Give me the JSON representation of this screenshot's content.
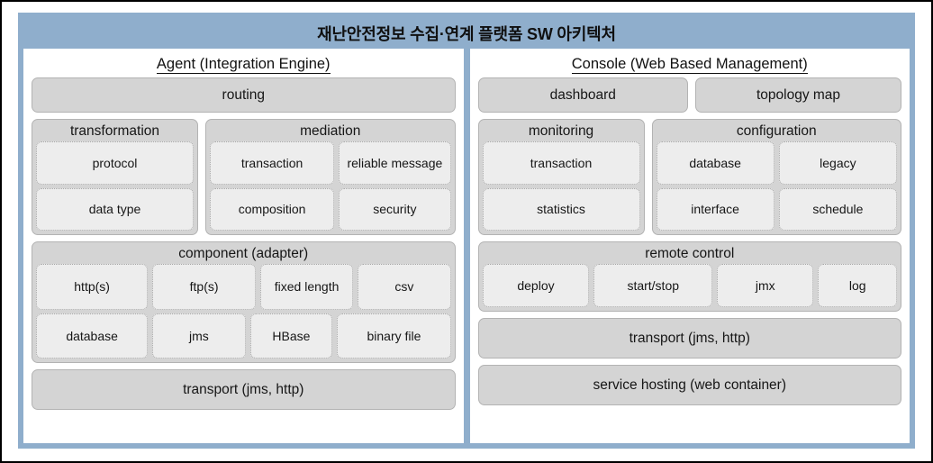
{
  "figure": {
    "title": "재난안전정보 수집·연계 플랫폼 SW 아키텍처",
    "frame_color": "#8FAECC",
    "module_fill": "#D4D4D4",
    "leaf_fill": "#EDEDED"
  },
  "left_panel": {
    "title": "Agent (Integration Engine)",
    "routing": {
      "label": "routing"
    },
    "transformation": {
      "label": "transformation",
      "items": [
        "protocol",
        "data type"
      ]
    },
    "mediation": {
      "label": "mediation",
      "row1": [
        "transaction",
        "reliable\nmessage"
      ],
      "row1_display": [
        "transaction",
        "reliable message"
      ],
      "row2": [
        "composition",
        "security"
      ]
    },
    "component": {
      "label": "component (adapter)",
      "row1": [
        "http(s)",
        "ftp(s)",
        "fixed length",
        "csv"
      ],
      "row2": [
        "database",
        "jms",
        "HBase",
        "binary file"
      ]
    },
    "transport": {
      "label": "transport (jms, http)"
    }
  },
  "right_panel": {
    "title": "Console (Web Based Management)",
    "top_row": [
      "dashboard",
      "topology map"
    ],
    "monitoring": {
      "label": "monitoring",
      "items": [
        "transaction",
        "statistics"
      ]
    },
    "configuration": {
      "label": "configuration",
      "row1": [
        "database",
        "legacy"
      ],
      "row2": [
        "interface",
        "schedule"
      ]
    },
    "remote_control": {
      "label": "remote control",
      "items": [
        "deploy",
        "start/stop",
        "jmx",
        "log"
      ]
    },
    "transport": {
      "label": "transport (jms, http)"
    },
    "service_hosting": {
      "label": "service hosting (web container)"
    }
  }
}
